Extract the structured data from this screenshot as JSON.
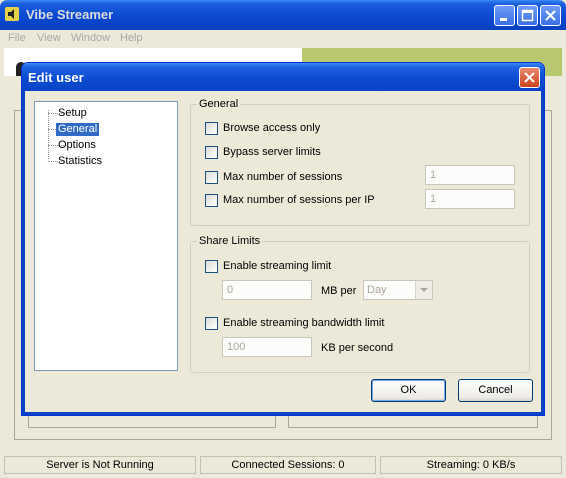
{
  "main_window": {
    "title": "Vibe Streamer",
    "menu": [
      "File",
      "View",
      "Window",
      "Help"
    ]
  },
  "status_bar": {
    "server": "Server is Not Running",
    "sessions": "Connected Sessions: 0",
    "streaming": "Streaming: 0 KB/s"
  },
  "dialog": {
    "title": "Edit user",
    "tree": {
      "items": [
        "Setup",
        "General",
        "Options",
        "Statistics"
      ],
      "selected": "General"
    },
    "general": {
      "title": "General",
      "browse_access_only": "Browse access only",
      "bypass_server_limits": "Bypass server limits",
      "max_sessions": "Max number of sessions",
      "max_sessions_value": "1",
      "max_sessions_per_ip": "Max number of sessions per IP",
      "max_sessions_per_ip_value": "1"
    },
    "share_limits": {
      "title": "Share Limits",
      "enable_streaming_limit": "Enable streaming limit",
      "streaming_limit_value": "0",
      "mb_per": "MB per",
      "period_selected": "Day",
      "enable_bandwidth_limit": "Enable streaming bandwidth limit",
      "bandwidth_value": "100",
      "kb_per_second": "KB per second"
    },
    "ok_label": "OK",
    "cancel_label": "Cancel"
  },
  "colors": {
    "titlebar_blue": "#0a49d0",
    "selection": "#316ac5",
    "close_red": "#c9431d",
    "face": "#ece9d8"
  }
}
